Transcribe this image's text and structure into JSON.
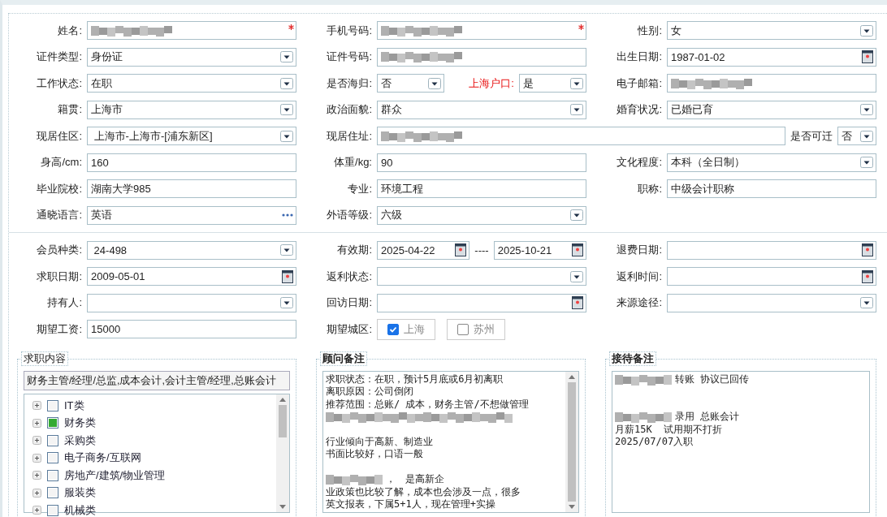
{
  "sections": [
    {
      "rows": [
        {
          "cells": [
            {
              "label": "姓名:",
              "required": true,
              "controls": [
                {
                  "kind": "text",
                  "redacted": true
                }
              ]
            },
            {
              "label": "手机号码:",
              "required": true,
              "controls": [
                {
                  "kind": "text",
                  "redacted": true
                }
              ]
            },
            {
              "label": "性别:",
              "controls": [
                {
                  "kind": "select",
                  "value": "女"
                }
              ]
            }
          ]
        },
        {
          "cells": [
            {
              "label": "证件类型:",
              "controls": [
                {
                  "kind": "select",
                  "value": "身份证"
                }
              ]
            },
            {
              "label": "证件号码:",
              "controls": [
                {
                  "kind": "text",
                  "redacted": true
                }
              ]
            },
            {
              "label": "出生日期:",
              "controls": [
                {
                  "kind": "date",
                  "value": "1987-01-02"
                }
              ]
            }
          ]
        },
        {
          "cells": [
            {
              "label": "工作状态:",
              "controls": [
                {
                  "kind": "select",
                  "value": "在职"
                }
              ]
            },
            {
              "label": "是否海归:",
              "controls": [
                {
                  "kind": "select",
                  "value": "否"
                },
                {
                  "kind": "label",
                  "text": "上海户口:",
                  "emphasis": true
                },
                {
                  "kind": "select",
                  "value": "是"
                }
              ]
            },
            {
              "label": "电子邮箱:",
              "controls": [
                {
                  "kind": "text",
                  "redacted": true
                }
              ]
            }
          ]
        },
        {
          "cells": [
            {
              "label": "籍贯:",
              "controls": [
                {
                  "kind": "select",
                  "value": "上海市"
                }
              ]
            },
            {
              "label": "政治面貌:",
              "controls": [
                {
                  "kind": "select",
                  "value": "群众"
                }
              ]
            },
            {
              "label": "婚育状况:",
              "controls": [
                {
                  "kind": "select",
                  "value": "已婚已育"
                }
              ]
            }
          ]
        },
        {
          "cells": [
            {
              "label": "现居住区:",
              "controls": [
                {
                  "kind": "select",
                  "value": " 上海市-上海市-[浦东新区]"
                }
              ]
            },
            {
              "label": "现居住址:",
              "kind": "wide",
              "controls": [
                {
                  "kind": "text",
                  "redacted": true
                },
                {
                  "kind": "label",
                  "text": "是否可迁"
                },
                {
                  "kind": "select",
                  "value": "否"
                }
              ]
            }
          ]
        },
        {
          "cells": [
            {
              "label": "身高/cm:",
              "controls": [
                {
                  "kind": "text",
                  "value": "160"
                }
              ]
            },
            {
              "label": "体重/kg:",
              "controls": [
                {
                  "kind": "text",
                  "value": "90"
                }
              ]
            },
            {
              "label": "文化程度:",
              "controls": [
                {
                  "kind": "select",
                  "value": "本科（全日制）"
                }
              ]
            }
          ]
        },
        {
          "cells": [
            {
              "label": "毕业院校:",
              "controls": [
                {
                  "kind": "text",
                  "value": "湖南大学985"
                }
              ]
            },
            {
              "label": "专业:",
              "controls": [
                {
                  "kind": "text",
                  "value": "环境工程"
                }
              ]
            },
            {
              "label": "职称:",
              "controls": [
                {
                  "kind": "text",
                  "value": "中级会计职称"
                }
              ]
            }
          ]
        },
        {
          "cells": [
            {
              "label": "通晓语言:",
              "controls": [
                {
                  "kind": "lookup",
                  "value": "英语"
                }
              ]
            },
            {
              "label": "外语等级:",
              "controls": [
                {
                  "kind": "select",
                  "value": "六级"
                }
              ]
            }
          ]
        }
      ]
    },
    {
      "rows": [
        {
          "cells": [
            {
              "label": "会员种类:",
              "controls": [
                {
                  "kind": "select",
                  "value": " 24-498"
                }
              ]
            },
            {
              "label": "有效期:",
              "controls": [
                {
                  "kind": "date",
                  "value": "2025-04-22"
                },
                {
                  "kind": "label",
                  "text": "----"
                },
                {
                  "kind": "date",
                  "value": "2025-10-21"
                }
              ]
            },
            {
              "label": "退费日期:",
              "controls": [
                {
                  "kind": "date"
                }
              ]
            }
          ]
        },
        {
          "cells": [
            {
              "label": "求职日期:",
              "controls": [
                {
                  "kind": "date",
                  "value": "2009-05-01"
                }
              ]
            },
            {
              "label": "返利状态:",
              "controls": [
                {
                  "kind": "select"
                }
              ]
            },
            {
              "label": "返利时间:",
              "controls": [
                {
                  "kind": "date"
                }
              ]
            }
          ]
        },
        {
          "cells": [
            {
              "label": "持有人:",
              "controls": [
                {
                  "kind": "select"
                }
              ]
            },
            {
              "label": "回访日期:",
              "controls": [
                {
                  "kind": "date"
                }
              ]
            },
            {
              "label": "来源途径:",
              "controls": [
                {
                  "kind": "select"
                }
              ]
            }
          ]
        },
        {
          "cells": [
            {
              "label": "期望工资:",
              "controls": [
                {
                  "kind": "text",
                  "value": "15000"
                }
              ]
            },
            {
              "label": "期望城区:",
              "controls": [
                {
                  "kind": "checkbox",
                  "text": "上海",
                  "checked": true
                },
                {
                  "kind": "checkbox",
                  "text": "苏州",
                  "checked": false
                }
              ]
            }
          ]
        }
      ]
    }
  ],
  "panels": [
    {
      "kind": "tree",
      "legend": "求职内容",
      "summary": "财务主管/经理/总监,成本会计,会计主管/经理,总账会计",
      "tree": [
        {
          "label": "IT类",
          "checked": false,
          "expanded": false
        },
        {
          "label": "财务类",
          "checked": true,
          "expanded": false
        },
        {
          "label": "采购类",
          "checked": false,
          "expanded": false
        },
        {
          "label": "电子商务/互联网",
          "checked": false,
          "expanded": false
        },
        {
          "label": "房地产/建筑/物业管理",
          "checked": false,
          "expanded": false
        },
        {
          "label": "服装类",
          "checked": false,
          "expanded": false
        },
        {
          "label": "机械类",
          "checked": false,
          "expanded": false
        }
      ]
    },
    {
      "kind": "notes",
      "legend": "顾问备注",
      "scrollbar": true,
      "lines": [
        {
          "kind": "text",
          "text": "求职状态：在职，预计5月底或6月初离职"
        },
        {
          "kind": "text",
          "text": "离职原因：公司倒闭"
        },
        {
          "kind": "text",
          "text": "推荐范围：总账/ 成本，财务主管/不想做管理"
        },
        {
          "kind": "redacted"
        },
        {
          "kind": "blank"
        },
        {
          "kind": "text",
          "text": "行业倾向于高新、制造业"
        },
        {
          "kind": "text",
          "text": "书面比较好，口语一般"
        },
        {
          "kind": "blank"
        },
        {
          "kind": "redacted_lead",
          "text": "，　是高新企"
        },
        {
          "kind": "text",
          "text": "业政策也比较了解，成本也会涉及一点，很多"
        },
        {
          "kind": "text",
          "text": "英文报表，下属5+1人，现在管理+实操"
        }
      ]
    },
    {
      "kind": "notes",
      "legend": "接待备注",
      "scrollbar": false,
      "lines": [
        {
          "kind": "redacted_lead",
          "text": "转账 协议已回传"
        },
        {
          "kind": "blank"
        },
        {
          "kind": "blank"
        },
        {
          "kind": "redacted_lead",
          "text": "录用 总账会计"
        },
        {
          "kind": "text",
          "text": "月薪15K  试用期不打折"
        },
        {
          "kind": "text",
          "text": "2025/07/07入职"
        }
      ]
    }
  ]
}
